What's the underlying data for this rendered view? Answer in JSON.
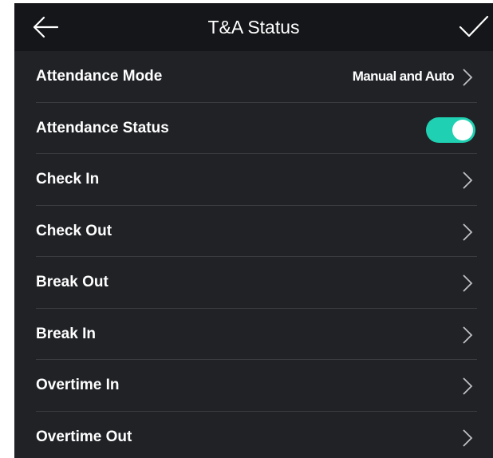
{
  "header": {
    "title": "T&A Status",
    "back_icon": "arrow-left-icon",
    "confirm_icon": "checkmark-icon"
  },
  "settings": {
    "attendance_mode": {
      "label": "Attendance Mode",
      "value": "Manual and Auto"
    },
    "attendance_status": {
      "label": "Attendance Status",
      "enabled": true,
      "toggle_color": "#1fd1b2"
    },
    "items": [
      {
        "label": "Check In"
      },
      {
        "label": "Check Out"
      },
      {
        "label": "Break Out"
      },
      {
        "label": "Break In"
      },
      {
        "label": "Overtime In"
      },
      {
        "label": "Overtime Out"
      }
    ]
  },
  "colors": {
    "background": "#202226",
    "header": "#151619",
    "divider": "#3a3c41",
    "accent": "#1fd1b2"
  }
}
